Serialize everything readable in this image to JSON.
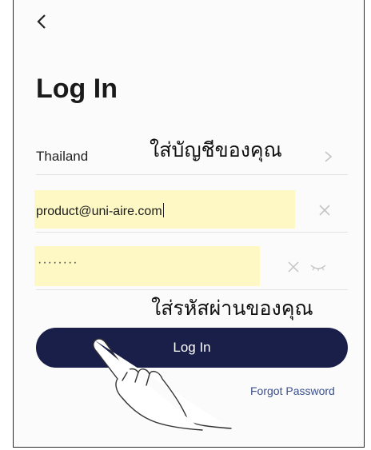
{
  "title": "Log In",
  "country": {
    "value": "Thailand"
  },
  "email": {
    "value": "product@uni-aire.com"
  },
  "password": {
    "value": "········"
  },
  "login_button": {
    "label": "Log In"
  },
  "forgot_password": {
    "label": "Forgot Password"
  },
  "annotations": {
    "account_hint": "ใส่บัญชีของคุณ",
    "password_hint": "ใส่รหัสผ่านของคุณ"
  },
  "colors": {
    "button_bg": "#1a1f4a",
    "link": "#3b4f8f",
    "highlight": "#fdf8c4"
  },
  "icons": [
    "chevron-left-icon",
    "chevron-right-icon",
    "close-icon",
    "eye-closed-icon",
    "hand-pointer-icon"
  ]
}
